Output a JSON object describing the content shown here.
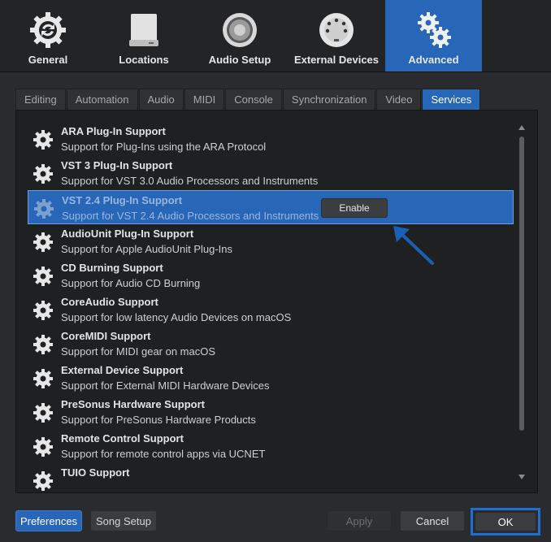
{
  "categories": [
    {
      "label": "General",
      "icon": "sync-gear-icon",
      "active": false
    },
    {
      "label": "Locations",
      "icon": "drive-icon",
      "active": false
    },
    {
      "label": "Audio Setup",
      "icon": "speaker-icon",
      "active": false
    },
    {
      "label": "External Devices",
      "icon": "midi-port-icon",
      "active": false
    },
    {
      "label": "Advanced",
      "icon": "gears-icon",
      "active": true
    }
  ],
  "tabs": [
    "Editing",
    "Automation",
    "Audio",
    "MIDI",
    "Console",
    "Synchronization",
    "Video",
    "Services"
  ],
  "active_tab": "Services",
  "services": [
    {
      "title": "ARA Plug-In Support",
      "desc": "Support for Plug-Ins using the ARA Protocol"
    },
    {
      "title": "VST 3 Plug-In Support",
      "desc": "Support for VST 3.0 Audio Processors and Instruments"
    },
    {
      "title": "VST 2.4 Plug-In Support",
      "desc": "Support for VST 2.4 Audio Processors and Instruments"
    },
    {
      "title": "AudioUnit Plug-In Support",
      "desc": "Support for Apple AudioUnit Plug-Ins"
    },
    {
      "title": "CD Burning Support",
      "desc": "Support for Audio CD Burning"
    },
    {
      "title": "CoreAudio Support",
      "desc": "Support for low latency Audio Devices on macOS"
    },
    {
      "title": "CoreMIDI Support",
      "desc": "Support for MIDI gear on macOS"
    },
    {
      "title": "External Device Support",
      "desc": "Support for External MIDI Hardware Devices"
    },
    {
      "title": "PreSonus Hardware Support",
      "desc": "Support for PreSonus Hardware Products"
    },
    {
      "title": "Remote Control Support",
      "desc": "Support for remote control apps via UCNET"
    },
    {
      "title": "TUIO Support",
      "desc": ""
    }
  ],
  "selected_service": "VST 2.4 Plug-In Support",
  "enable_label": "Enable",
  "footer": {
    "preferences": "Preferences",
    "song_setup": "Song Setup",
    "apply": "Apply",
    "cancel": "Cancel",
    "ok": "OK"
  },
  "colors": {
    "accent": "#2866b8",
    "highlight_frame": "#1e6fd0",
    "arrow": "#1a5fb4"
  }
}
